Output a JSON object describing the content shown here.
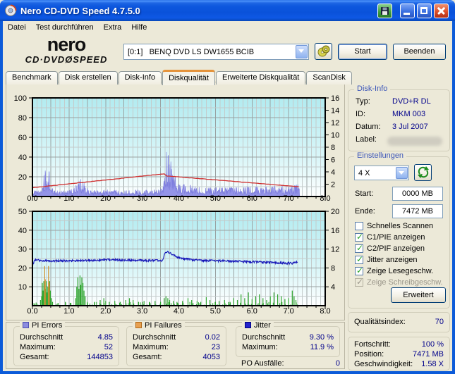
{
  "window": {
    "title": "Nero CD-DVD Speed 4.7.5.0"
  },
  "menu": {
    "items": [
      "Datei",
      "Test durchführen",
      "Extra",
      "Hilfe"
    ]
  },
  "toolbar": {
    "logo_top": "nero",
    "logo_bottom": "CD·DVDØSPEED",
    "drive_selected": "[0:1]   BENQ DVD LS DW1655 BCIB",
    "start_label": "Start",
    "quit_label": "Beenden"
  },
  "tabs": [
    {
      "label": "Benchmark",
      "active": false
    },
    {
      "label": "Disk erstellen",
      "active": false
    },
    {
      "label": "Disk-Info",
      "active": false
    },
    {
      "label": "Diskqualität",
      "active": true
    },
    {
      "label": "Erweiterte Diskqualität",
      "active": false
    },
    {
      "label": "ScanDisk",
      "active": false
    }
  ],
  "disk_info": {
    "title": "Disk-Info",
    "rows": [
      {
        "label": "Typ:",
        "value": "DVD+R DL"
      },
      {
        "label": "ID:",
        "value": "MKM 003"
      },
      {
        "label": "Datum:",
        "value": "3 Jul 2007"
      },
      {
        "label": "Label:",
        "value": ""
      }
    ]
  },
  "settings": {
    "title": "Einstellungen",
    "speed_selected": "4 X",
    "start_label": "Start:",
    "start_value": "0000 MB",
    "end_label": "Ende:",
    "end_value": "7472 MB",
    "checkboxes": [
      {
        "label": "Schnelles Scannen",
        "checked": false,
        "disabled": false
      },
      {
        "label": "C1/PIE anzeigen",
        "checked": true,
        "disabled": false
      },
      {
        "label": "C2/PIF anzeigen",
        "checked": true,
        "disabled": false
      },
      {
        "label": "Jitter anzeigen",
        "checked": true,
        "disabled": false
      },
      {
        "label": "Zeige Lesegeschw.",
        "checked": true,
        "disabled": false
      },
      {
        "label": "Zeige Schreibgeschw.",
        "checked": true,
        "disabled": true
      }
    ],
    "advanced_label": "Erweitert"
  },
  "quality": {
    "label": "Qualitätsindex:",
    "value": "70"
  },
  "progress": {
    "rows": [
      {
        "label": "Fortschritt:",
        "value": "100 %"
      },
      {
        "label": "Position:",
        "value": "7471 MB"
      },
      {
        "label": "Geschwindigkeit:",
        "value": "1.58 X"
      }
    ]
  },
  "stats": {
    "pi_errors": {
      "title": "PI Errors",
      "color": "#8c8cdf",
      "border": "#5050b0",
      "rows": [
        {
          "label": "Durchschnitt",
          "value": "4.85"
        },
        {
          "label": "Maximum:",
          "value": "52"
        },
        {
          "label": "Gesamt:",
          "value": "144853"
        }
      ]
    },
    "pi_failures": {
      "title": "PI Failures",
      "color": "#e8a050",
      "border": "#b06818",
      "rows": [
        {
          "label": "Durchschnitt",
          "value": "0.02"
        },
        {
          "label": "Maximum:",
          "value": "23"
        },
        {
          "label": "Gesamt:",
          "value": "4053"
        }
      ]
    },
    "jitter": {
      "title": "Jitter",
      "color": "#2222cc",
      "border": "#000080",
      "rows": [
        {
          "label": "Durchschnitt",
          "value": "9.30 %"
        },
        {
          "label": "Maximum:",
          "value": "11.9 %"
        }
      ]
    },
    "po_label": "PO Ausfälle:",
    "po_value": "0"
  },
  "chart_data": [
    {
      "type": "area",
      "name": "pi-errors-and-read-speed",
      "x": {
        "min": 0,
        "max": 8,
        "label_step": 1,
        "minor_step": 0.125,
        "major_step": 0.5,
        "unit": "GB"
      },
      "y_left": {
        "min": 0,
        "max": 100,
        "label_step": 20,
        "grid_step": 10
      },
      "y_right": {
        "min": 0,
        "max": 16,
        "label_step": 2
      },
      "data_end": 7.3,
      "series": [
        {
          "name": "PI Errors",
          "kind": "noise-area",
          "axis": "left",
          "color": "#9494e8",
          "edge": "#7e7ede",
          "envelope": [
            [
              0,
              6
            ],
            [
              0.2,
              6
            ],
            [
              0.28,
              14
            ],
            [
              0.33,
              30
            ],
            [
              0.37,
              22
            ],
            [
              0.42,
              26
            ],
            [
              0.47,
              30
            ],
            [
              0.52,
              10
            ],
            [
              0.6,
              6
            ],
            [
              1.0,
              6
            ],
            [
              1.15,
              9
            ],
            [
              1.2,
              16
            ],
            [
              1.25,
              13
            ],
            [
              1.3,
              19
            ],
            [
              1.35,
              16
            ],
            [
              1.4,
              18
            ],
            [
              1.45,
              10
            ],
            [
              1.55,
              6
            ],
            [
              1.8,
              6
            ],
            [
              2.0,
              7
            ],
            [
              2.5,
              6
            ],
            [
              3.0,
              7
            ],
            [
              3.4,
              7
            ],
            [
              3.55,
              8
            ],
            [
              3.62,
              20
            ],
            [
              3.66,
              52
            ],
            [
              3.7,
              56
            ],
            [
              3.74,
              44
            ],
            [
              3.8,
              34
            ],
            [
              3.86,
              26
            ],
            [
              3.92,
              18
            ],
            [
              4.0,
              14
            ],
            [
              4.1,
              12
            ],
            [
              4.2,
              13
            ],
            [
              4.35,
              11
            ],
            [
              4.5,
              10
            ],
            [
              4.7,
              9
            ],
            [
              5.0,
              9
            ],
            [
              5.5,
              9
            ],
            [
              5.9,
              10
            ],
            [
              6.2,
              10
            ],
            [
              6.5,
              10
            ],
            [
              6.8,
              11
            ],
            [
              7.0,
              11
            ],
            [
              7.15,
              12
            ],
            [
              7.3,
              12
            ]
          ]
        },
        {
          "name": "Lesegeschwindigkeit",
          "kind": "seg-line",
          "axis": "right",
          "color": "#cf2f2f",
          "noise": 0.05,
          "points": [
            [
              0,
              1.42
            ],
            [
              3.62,
              3.7
            ],
            [
              3.65,
              3.35
            ],
            [
              7.3,
              1.58
            ]
          ]
        }
      ]
    },
    {
      "type": "line",
      "name": "jitter-and-pi-failures",
      "x": {
        "min": 0,
        "max": 8,
        "label_step": 1,
        "minor_step": 0.125,
        "major_step": 0.5,
        "unit": "GB"
      },
      "y_left": {
        "min": 0,
        "max": 50,
        "label_step": 10,
        "grid_step": 5
      },
      "y_right": {
        "min": 0,
        "max": 20,
        "label_step": 4
      },
      "data_end": 7.25,
      "series": [
        {
          "name": "micro-failures",
          "kind": "micro-bars",
          "axis": "left",
          "color": "#2fa52f",
          "density": 0.45,
          "hmax": 1.8
        },
        {
          "name": "PI Failures",
          "kind": "bars",
          "axis": "left",
          "color": "#2fa52f",
          "bars": [
            [
              0.22,
              3
            ],
            [
              0.25,
              5
            ],
            [
              0.27,
              12
            ],
            [
              0.29,
              8
            ],
            [
              0.31,
              13
            ],
            [
              0.36,
              9
            ],
            [
              0.38,
              13
            ],
            [
              0.4,
              7
            ],
            [
              0.42,
              10
            ],
            [
              0.47,
              13
            ],
            [
              0.49,
              8
            ],
            [
              0.52,
              4
            ],
            [
              0.55,
              2
            ],
            [
              0.7,
              1.5
            ],
            [
              0.9,
              2
            ],
            [
              1.05,
              1.5
            ],
            [
              1.18,
              4
            ],
            [
              1.21,
              10
            ],
            [
              1.24,
              15
            ],
            [
              1.27,
              9
            ],
            [
              1.3,
              16
            ],
            [
              1.32,
              11
            ],
            [
              1.35,
              15
            ],
            [
              1.38,
              12
            ],
            [
              1.41,
              8
            ],
            [
              1.44,
              5
            ],
            [
              1.5,
              2
            ],
            [
              1.7,
              2
            ],
            [
              1.85,
              3
            ],
            [
              1.95,
              4
            ],
            [
              2.0,
              2.5
            ],
            [
              2.1,
              2
            ],
            [
              2.25,
              2.5
            ],
            [
              2.4,
              2
            ],
            [
              2.55,
              3
            ],
            [
              2.65,
              4
            ],
            [
              2.75,
              3
            ],
            [
              2.9,
              2
            ],
            [
              3.05,
              2.5
            ],
            [
              3.2,
              2
            ],
            [
              3.35,
              2.5
            ],
            [
              3.5,
              2
            ],
            [
              3.6,
              4
            ],
            [
              3.65,
              5
            ],
            [
              3.7,
              4
            ],
            [
              3.75,
              3
            ],
            [
              3.85,
              2.5
            ],
            [
              3.95,
              2
            ],
            [
              4.1,
              2.5
            ],
            [
              4.25,
              4
            ],
            [
              4.35,
              3
            ],
            [
              4.5,
              2.5
            ],
            [
              4.6,
              2
            ],
            [
              4.75,
              4.5
            ],
            [
              4.85,
              3
            ],
            [
              5.0,
              2
            ],
            [
              5.1,
              2.5
            ],
            [
              5.25,
              3
            ],
            [
              5.4,
              2
            ],
            [
              5.5,
              4
            ],
            [
              5.6,
              3
            ],
            [
              5.7,
              6
            ],
            [
              5.8,
              4
            ],
            [
              5.9,
              7
            ],
            [
              6.0,
              3.5
            ],
            [
              6.1,
              5
            ],
            [
              6.2,
              6
            ],
            [
              6.3,
              4
            ],
            [
              6.4,
              3
            ],
            [
              6.5,
              5
            ],
            [
              6.6,
              7
            ],
            [
              6.7,
              6
            ],
            [
              6.8,
              5
            ],
            [
              6.9,
              3.5
            ],
            [
              7.0,
              4
            ],
            [
              7.1,
              8
            ],
            [
              7.15,
              5
            ],
            [
              7.2,
              3
            ]
          ]
        },
        {
          "name": "PI Failures peaks",
          "kind": "bars",
          "axis": "left",
          "color": "#cf8f2e",
          "bars": [
            [
              0.335,
              21
            ],
            [
              0.35,
              14
            ],
            [
              0.44,
              21
            ],
            [
              0.46,
              12
            ]
          ]
        },
        {
          "name": "Jitter",
          "kind": "noise-line",
          "axis": "right",
          "color": "#1717b8",
          "noise": 0.45,
          "envelope": [
            [
              0,
              8.6
            ],
            [
              0.08,
              9.8
            ],
            [
              0.2,
              9.5
            ],
            [
              1.0,
              9.5
            ],
            [
              2.0,
              9.7
            ],
            [
              3.0,
              9.6
            ],
            [
              3.55,
              9.5
            ],
            [
              3.63,
              11.3
            ],
            [
              3.72,
              11.4
            ],
            [
              3.82,
              10.8
            ],
            [
              3.95,
              10.3
            ],
            [
              4.1,
              10.0
            ],
            [
              4.3,
              9.8
            ],
            [
              4.6,
              9.6
            ],
            [
              5.0,
              9.5
            ],
            [
              5.5,
              9.4
            ],
            [
              6.0,
              9.3
            ],
            [
              6.5,
              9.15
            ],
            [
              6.9,
              9.0
            ],
            [
              7.1,
              9.0
            ],
            [
              7.25,
              9.3
            ]
          ]
        }
      ]
    }
  ]
}
